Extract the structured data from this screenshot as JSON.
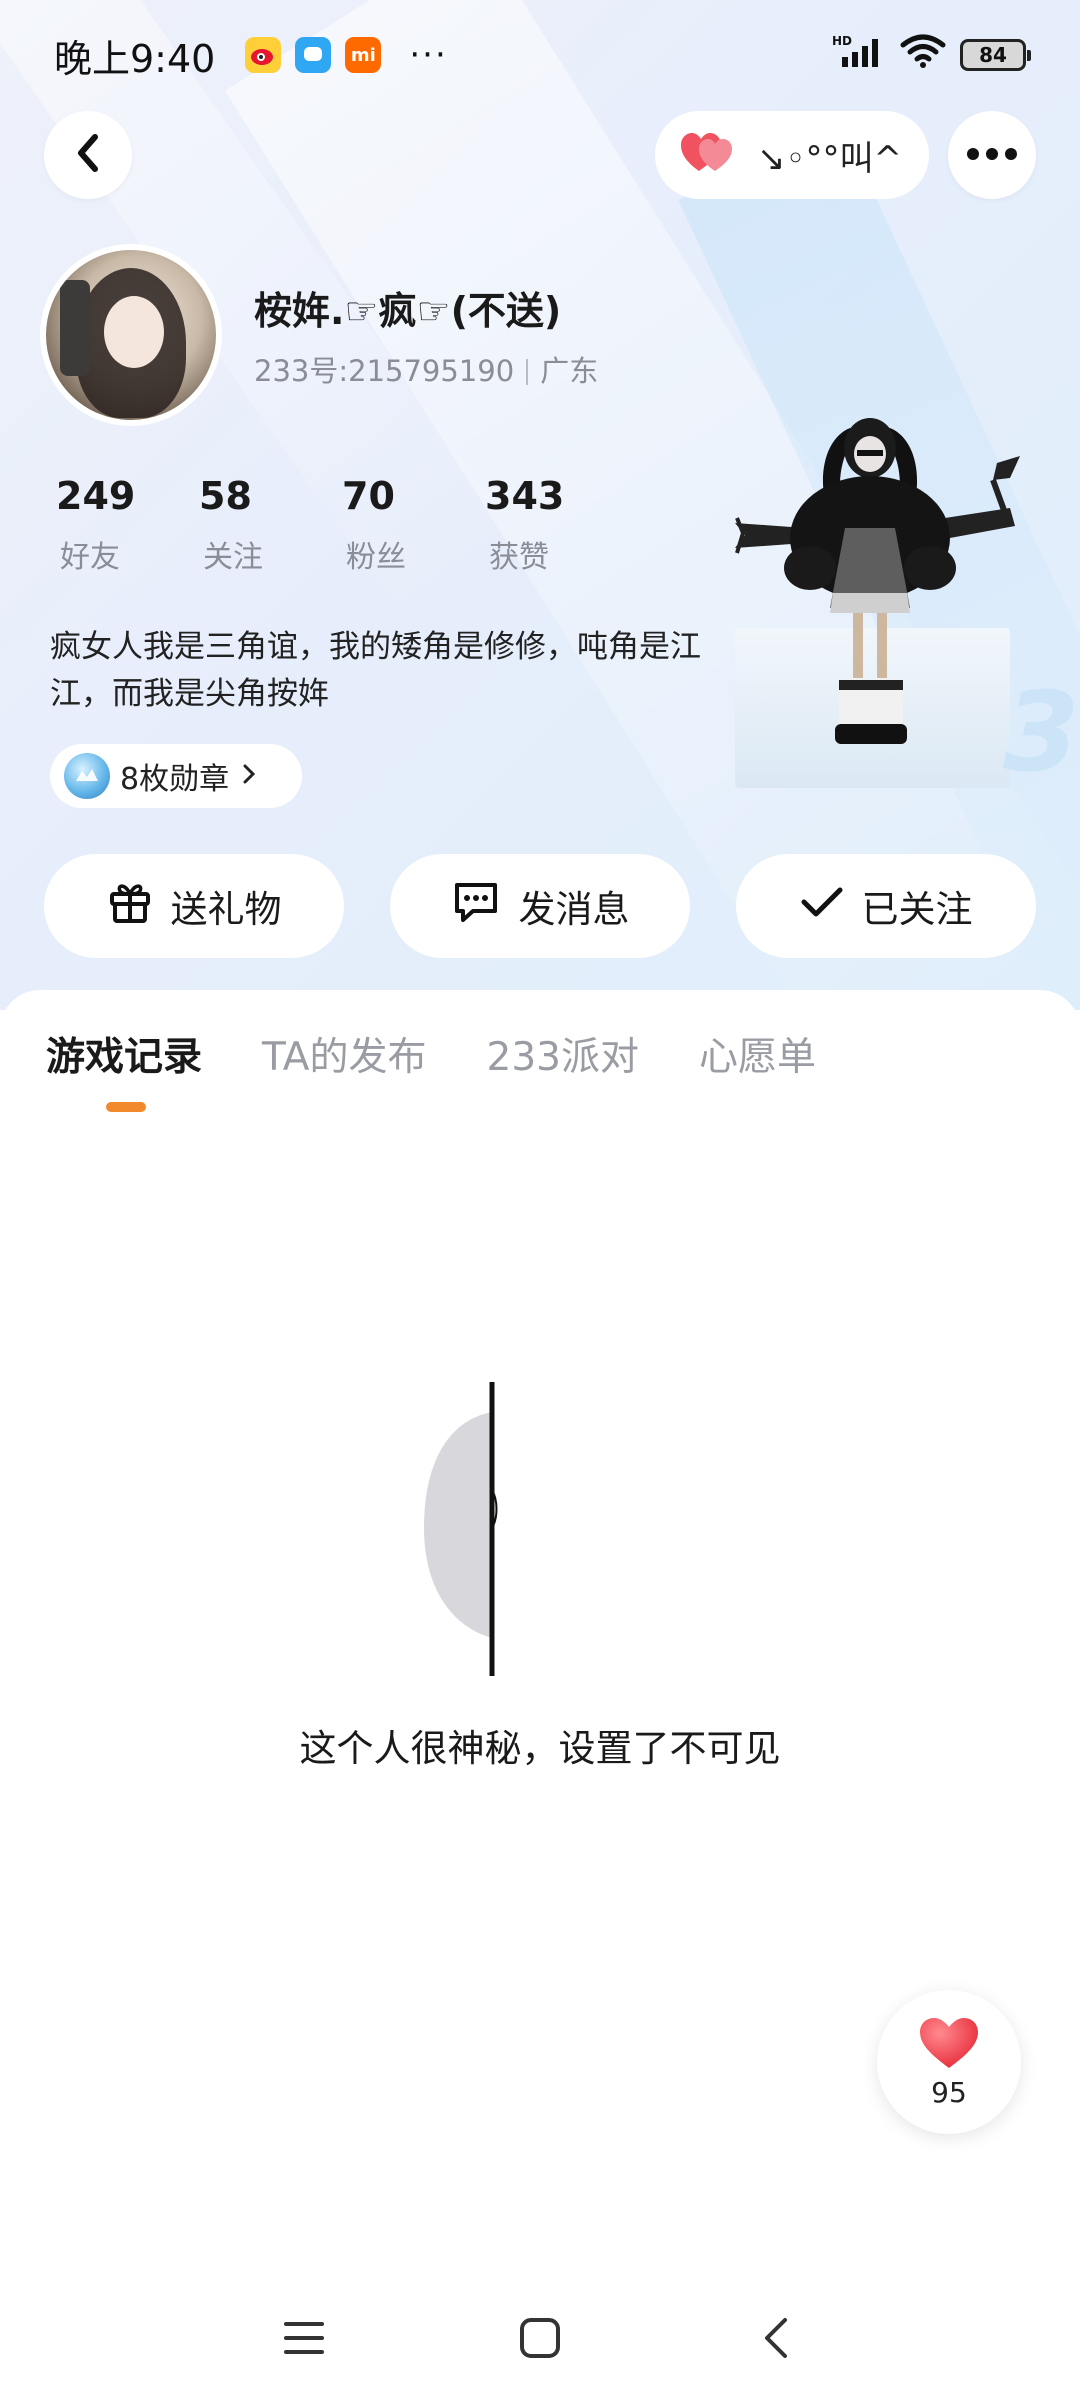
{
  "status_bar": {
    "time": "晚上9:40",
    "app_icons": [
      "weibo-icon",
      "chat-app-icon",
      "mi-icon"
    ],
    "mi_label": "mi",
    "more": "···",
    "network": "HD",
    "battery": "84"
  },
  "top_nav": {
    "back_icon": "back-arrow-icon",
    "pill_text": "↘◦°°叫^...",
    "more_icon": "more-dots-icon"
  },
  "profile": {
    "name": "桉姩.☞疯☞(不送)",
    "id": "233号:215795190",
    "region": "广东",
    "stats": [
      {
        "num": "249",
        "label": "好友"
      },
      {
        "num": "58",
        "label": "关注"
      },
      {
        "num": "70",
        "label": "粉丝"
      },
      {
        "num": "343",
        "label": "获赞"
      }
    ],
    "bio": "疯女人我是三角谊，我的矮角是修修，吨角是江江，而我是尖角按姩",
    "badges": "8枚勋章"
  },
  "actions": {
    "gift": "送礼物",
    "message": "发消息",
    "follow": "已关注"
  },
  "tabs": [
    "游戏记录",
    "TA的发布",
    "233派对",
    "心愿单"
  ],
  "content": {
    "empty_message": "这个人很神秘，设置了不可见"
  },
  "like": {
    "count": "95"
  },
  "colors": {
    "accent": "#f28a2b",
    "like": "#f0535f"
  }
}
